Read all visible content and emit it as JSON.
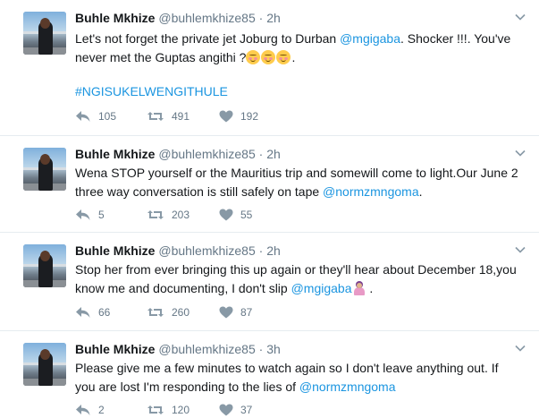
{
  "tweets": [
    {
      "name": "Buhle Mkhize",
      "handle": "@buhlemkhize85",
      "separator": "·",
      "time": "2h",
      "text_parts": [
        "Let's not forget the private jet Joburg to Durban ",
        "@mgigaba",
        ". Shocker !!!. You've",
        "never met the Guptas angithi ?",
        "."
      ],
      "emoji_names": [
        "smiling-face-with-blush-icon",
        "smiling-face-with-blush-icon",
        "smiling-face-with-blush-icon"
      ],
      "hashtag": "#NGISUKELWENGITHULE",
      "replies": "105",
      "retweets": "491",
      "likes": "192"
    },
    {
      "name": "Buhle Mkhize",
      "handle": "@buhlemkhize85",
      "separator": "·",
      "time": "2h",
      "text_parts": [
        "Wena STOP yourself or the Mauritius trip and somewill come to light.Our June 2",
        "three way conversation is still safely on tape ",
        "@normzmngoma",
        "."
      ],
      "replies": "5",
      "retweets": "203",
      "likes": "55"
    },
    {
      "name": "Buhle Mkhize",
      "handle": "@buhlemkhize85",
      "separator": "·",
      "time": "2h",
      "text_parts": [
        "Stop her from ever bringing this up again or they'll hear about December 18,you",
        "know me and documenting, I don't slip ",
        "@mgigaba",
        " ."
      ],
      "emoji_names": [
        "person-raising-hand-icon"
      ],
      "replies": "66",
      "retweets": "260",
      "likes": "87"
    },
    {
      "name": "Buhle Mkhize",
      "handle": "@buhlemkhize85",
      "separator": "·",
      "time": "3h",
      "text_parts": [
        "Please give me a few minutes to watch again so I don't leave anything out. If",
        "you are lost I'm responding to the lies of ",
        "@normzmngoma"
      ],
      "replies": "2",
      "retweets": "120",
      "likes": "37"
    }
  ],
  "colors": {
    "link": "#1b95e0",
    "muted": "#657786",
    "text": "#14171a",
    "divider": "#e6ecf0"
  },
  "icons": [
    "reply-icon",
    "retweet-icon",
    "like-icon",
    "chevron-down-icon"
  ]
}
